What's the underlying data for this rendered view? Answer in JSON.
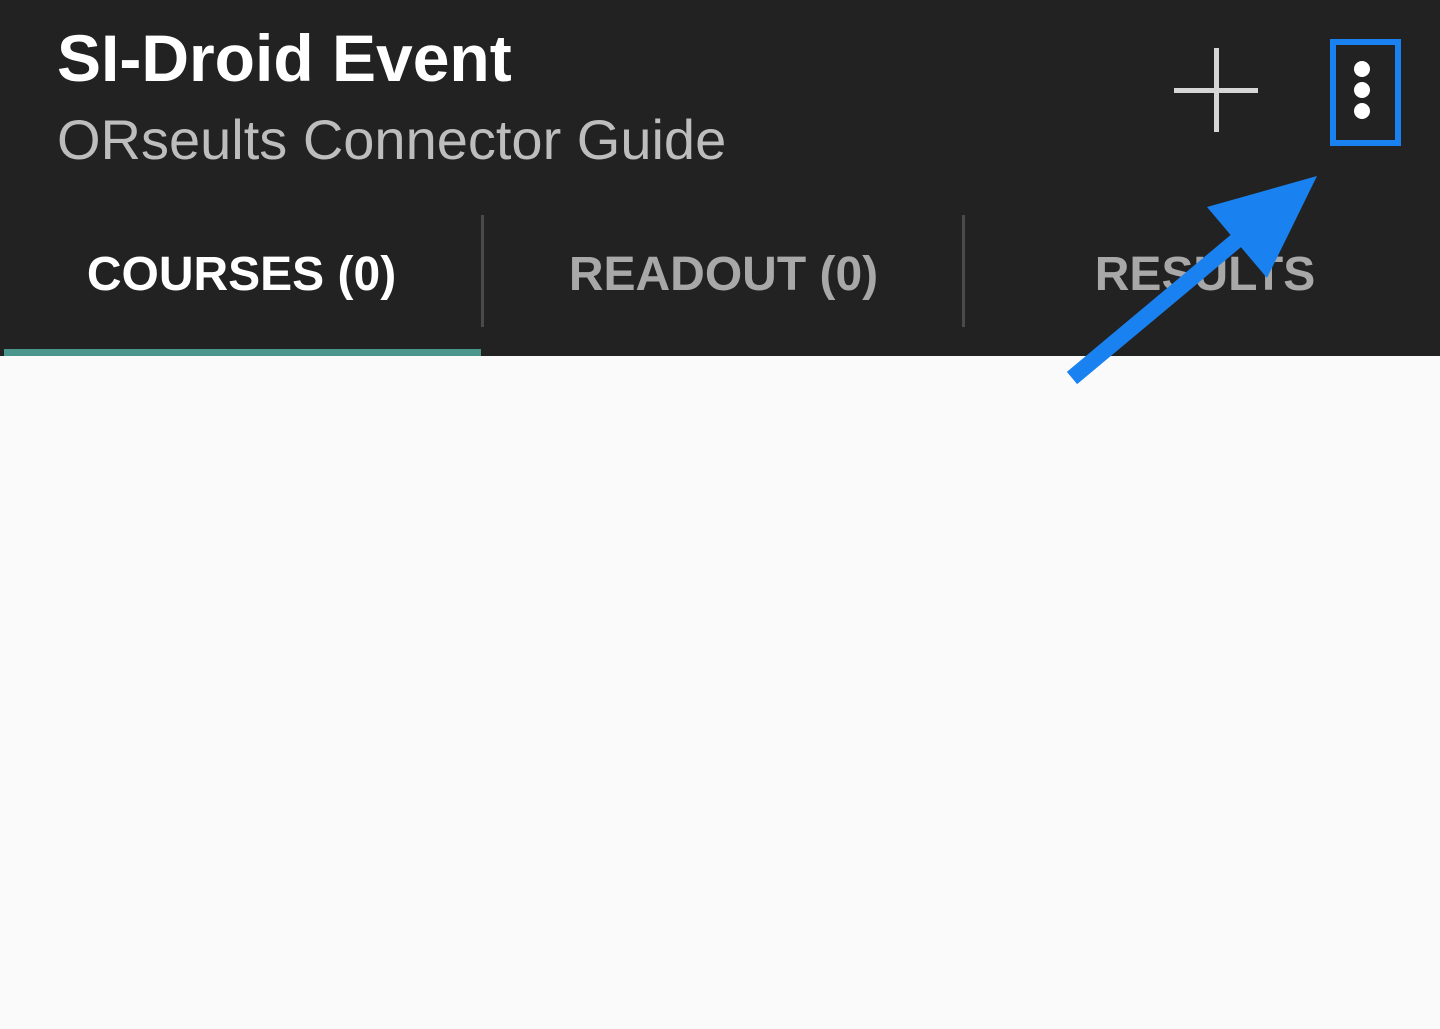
{
  "app_bar": {
    "title": "SI-Droid Event",
    "subtitle": "ORseults Connector Guide",
    "actions": {
      "add_icon": "plus-icon",
      "overflow_icon": "more-vert-icon"
    }
  },
  "tabs": [
    {
      "label": "COURSES (0)",
      "active": true
    },
    {
      "label": "READOUT (0)",
      "active": false
    },
    {
      "label": "RESULTS",
      "active": false
    }
  ],
  "annotation": {
    "highlight_color": "#1a82f0",
    "arrow_color": "#1a82f0",
    "target": "overflow-menu-button"
  },
  "colors": {
    "app_bar_bg": "#222222",
    "tab_indicator": "#4a968c",
    "content_bg": "#fafafa"
  }
}
